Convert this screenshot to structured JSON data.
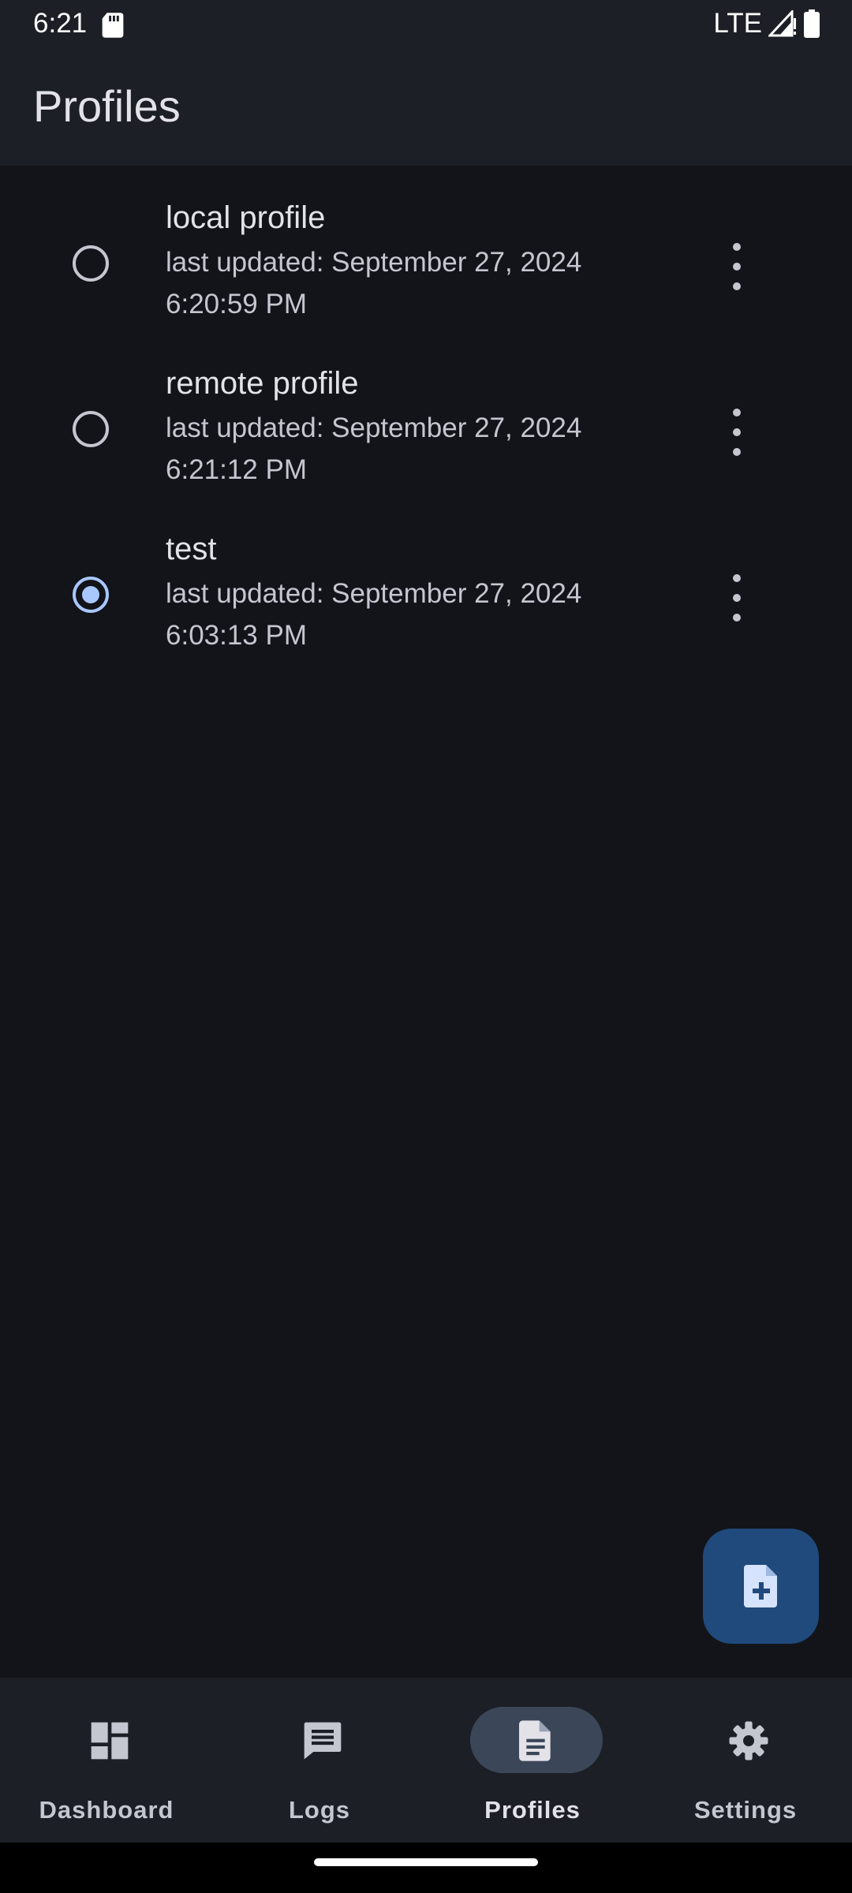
{
  "status_bar": {
    "time": "6:21",
    "network": "LTE",
    "icons": [
      "sd-card-icon",
      "signal-icon",
      "battery-icon"
    ]
  },
  "app_bar": {
    "title": "Profiles"
  },
  "profiles": [
    {
      "name": "local profile",
      "subtitle": "last updated: September 27, 2024 6:20:59 PM",
      "selected": false
    },
    {
      "name": "remote profile",
      "subtitle": "last updated: September 27, 2024 6:21:12 PM",
      "selected": false
    },
    {
      "name": "test",
      "subtitle": "last updated: September 27, 2024 6:03:13 PM",
      "selected": true
    }
  ],
  "fab": {
    "icon": "add-file-icon"
  },
  "nav": {
    "items": [
      {
        "label": "Dashboard",
        "icon": "dashboard-icon",
        "active": false
      },
      {
        "label": "Logs",
        "icon": "chat-icon",
        "active": false
      },
      {
        "label": "Profiles",
        "icon": "document-icon",
        "active": true
      },
      {
        "label": "Settings",
        "icon": "gear-icon",
        "active": false
      }
    ]
  },
  "colors": {
    "background": "#131419",
    "surface": "#1c1f25",
    "accent": "#a9c7ff",
    "fab": "#204a7c",
    "nav_active_pill": "#3b4758"
  }
}
